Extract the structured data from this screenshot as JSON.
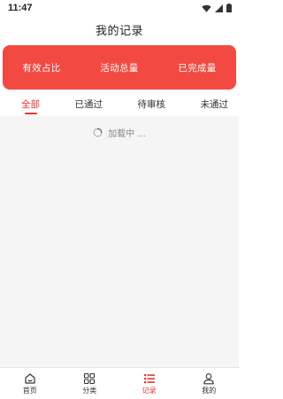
{
  "status": {
    "time": "11:47"
  },
  "header": {
    "title": "我的记录"
  },
  "stats": [
    {
      "label": "有效占比"
    },
    {
      "label": "活动总量"
    },
    {
      "label": "已完成量"
    }
  ],
  "tabs": [
    {
      "label": "全部",
      "active": true
    },
    {
      "label": "已通过"
    },
    {
      "label": "待审核"
    },
    {
      "label": "未通过"
    }
  ],
  "loading": {
    "text": "加载中 ..."
  },
  "tabbar": [
    {
      "label": "首页",
      "icon": "home-icon"
    },
    {
      "label": "分类",
      "icon": "grid-icon"
    },
    {
      "label": "记录",
      "icon": "list-icon",
      "active": true
    },
    {
      "label": "我的",
      "icon": "user-icon"
    }
  ],
  "colors": {
    "accent": "#e8362d",
    "card": "#f24a40",
    "content_bg": "#f5f5f5"
  }
}
